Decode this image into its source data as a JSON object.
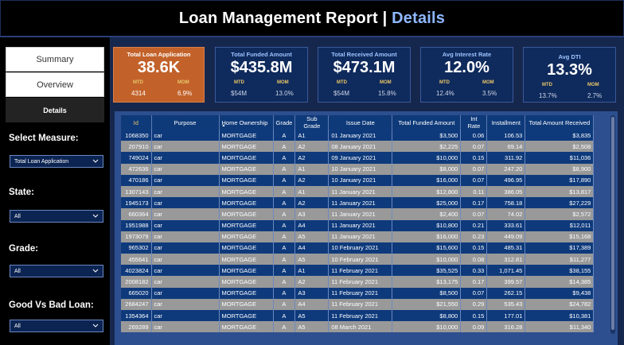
{
  "header": {
    "title_main": "Loan Management Report",
    "title_sep": " | ",
    "title_accent": "Details"
  },
  "nav": {
    "summary": "Summary",
    "overview": "Overview",
    "details": "Details"
  },
  "filters": [
    {
      "label": "Select Measure:",
      "value": "Total Loan Application"
    },
    {
      "label": "State:",
      "value": "All"
    },
    {
      "label": "Grade:",
      "value": "All"
    },
    {
      "label": "Good Vs Bad Loan:",
      "value": "All"
    }
  ],
  "kpis": [
    {
      "title": "Total Loan Application",
      "value": "38.6K",
      "mtd_label": "MTD",
      "mom_label": "MOM",
      "mtd": "4314",
      "mom": "6.9%"
    },
    {
      "title": "Total Funded Amount",
      "value": "$435.8M",
      "mtd_label": "MTD",
      "mom_label": "MOM",
      "mtd": "$54M",
      "mom": "13.0%"
    },
    {
      "title": "Total Received Amount",
      "value": "$473.1M",
      "mtd_label": "MTD",
      "mom_label": "MOM",
      "mtd": "$54M",
      "mom": "15.8%"
    },
    {
      "title": "Avg Interest Rate",
      "value": "12.0%",
      "mtd_label": "MTD",
      "mom_label": "MOM",
      "mtd": "12.4%",
      "mom": "3.5%"
    },
    {
      "title": "Avg DTI",
      "value": "13.3%",
      "mtd_label": "MTD",
      "mom_label": "MOM",
      "mtd": "13.7%",
      "mom": "2.7%"
    }
  ],
  "table": {
    "columns": [
      "Id",
      "Purpose",
      "Home Ownership",
      "Grade",
      "Sub Grade",
      "Issue Date",
      "Total Funded Amount",
      "Int Rate",
      "Installment",
      "Total Amount Received"
    ],
    "sort_indicator": "▲",
    "rows": [
      [
        "1068350",
        "car",
        "MORTGAGE",
        "A",
        "A1",
        "01 January 2021",
        "$3,500",
        "0.06",
        "106.53",
        "$3,835"
      ],
      [
        "207910",
        "car",
        "MORTGAGE",
        "A",
        "A2",
        "08 January 2021",
        "$2,225",
        "0.07",
        "69.14",
        "$2,508"
      ],
      [
        "749024",
        "car",
        "MORTGAGE",
        "A",
        "A2",
        "09 January 2021",
        "$10,000",
        "0.15",
        "311.92",
        "$11,036"
      ],
      [
        "472636",
        "car",
        "MORTGAGE",
        "A",
        "A1",
        "10 January 2021",
        "$8,000",
        "0.07",
        "247.20",
        "$8,900"
      ],
      [
        "470186",
        "car",
        "MORTGAGE",
        "A",
        "A2",
        "10 January 2021",
        "$16,000",
        "0.07",
        "496.95",
        "$17,890"
      ],
      [
        "1307143",
        "car",
        "MORTGAGE",
        "A",
        "A1",
        "11 January 2021",
        "$12,800",
        "0.11",
        "386.05",
        "$13,817"
      ],
      [
        "1945173",
        "car",
        "MORTGAGE",
        "A",
        "A2",
        "11 January 2021",
        "$25,000",
        "0.17",
        "758.18",
        "$27,229"
      ],
      [
        "660364",
        "car",
        "MORTGAGE",
        "A",
        "A3",
        "11 January 2021",
        "$2,400",
        "0.07",
        "74.02",
        "$2,572"
      ],
      [
        "1951988",
        "car",
        "MORTGAGE",
        "A",
        "A4",
        "11 January 2021",
        "$10,800",
        "0.21",
        "333.61",
        "$12,011"
      ],
      [
        "1973079",
        "car",
        "MORTGAGE",
        "A",
        "A5",
        "11 January 2021",
        "$16,000",
        "0.23",
        "449.09",
        "$15,168"
      ],
      [
        "965302",
        "car",
        "MORTGAGE",
        "A",
        "A4",
        "10 February 2021",
        "$15,600",
        "0.15",
        "485.31",
        "$17,389"
      ],
      [
        "455641",
        "car",
        "MORTGAGE",
        "A",
        "A5",
        "10 February 2021",
        "$10,000",
        "0.08",
        "312.81",
        "$11,277"
      ],
      [
        "4023824",
        "car",
        "MORTGAGE",
        "A",
        "A1",
        "11 February 2021",
        "$35,525",
        "0.33",
        "1,071.45",
        "$38,155"
      ],
      [
        "2008182",
        "car",
        "MORTGAGE",
        "A",
        "A2",
        "11 February 2021",
        "$13,175",
        "0.17",
        "399.57",
        "$14,385"
      ],
      [
        "665020",
        "car",
        "MORTGAGE",
        "A",
        "A3",
        "11 February 2021",
        "$8,500",
        "0.07",
        "262.15",
        "$9,438"
      ],
      [
        "2684247",
        "car",
        "MORTGAGE",
        "A",
        "A4",
        "11 February 2021",
        "$21,550",
        "0.29",
        "535.43",
        "$24,782"
      ],
      [
        "1354364",
        "car",
        "MORTGAGE",
        "A",
        "A5",
        "11 February 2021",
        "$8,800",
        "0.15",
        "177.01",
        "$10,381"
      ],
      [
        "269289",
        "car",
        "MORTGAGE",
        "A",
        "A5",
        "08 March 2021",
        "$10,000",
        "0.09",
        "316.28",
        "$11,340"
      ]
    ]
  },
  "colors": {
    "accent": "#8fb8ff",
    "kpi_highlight": "#c2622a",
    "kpi_bg": "#0f2a5c",
    "row_blue": "#0e3a7c",
    "row_gray": "#999999",
    "label_gold": "#e8c66a"
  }
}
